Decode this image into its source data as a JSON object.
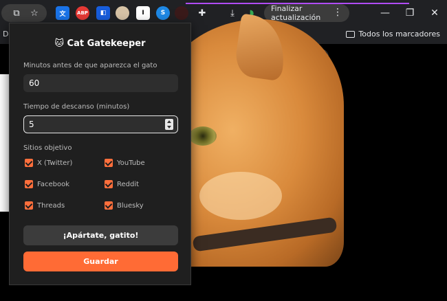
{
  "toolbar": {
    "update_label": "Finalizar actualización",
    "icons": [
      "install-icon",
      "star-icon",
      "translate-icon",
      "adblock-icon",
      "bitwarden-icon",
      "avatar-icon",
      "instapaper-icon",
      "shazam-icon",
      "cat-extension-icon",
      "puzzle-icon",
      "download-icon",
      "vpn-icon"
    ],
    "abp_text": "ABP"
  },
  "bookmarks": {
    "left_text": "DI",
    "all_bookmarks": "Todos los marcadores"
  },
  "popup": {
    "title": "🐱 Cat Gatekeeper",
    "minutes_label": "Minutos antes de que aparezca el gato",
    "minutes_value": "60",
    "rest_label": "Tiempo de descanso (minutos)",
    "rest_value": "5",
    "sites_label": "Sitios objetivo",
    "sites": [
      {
        "label": "X (Twitter)",
        "checked": true
      },
      {
        "label": "YouTube",
        "checked": true
      },
      {
        "label": "Facebook",
        "checked": true
      },
      {
        "label": "Reddit",
        "checked": true
      },
      {
        "label": "Threads",
        "checked": true
      },
      {
        "label": "Bluesky",
        "checked": true
      }
    ],
    "dismiss_button": "¡Apártate, gatito!",
    "save_button": "Guardar"
  },
  "colors": {
    "accent": "#ff6b35",
    "popup_bg": "#1f1f1f",
    "toolbar_bg": "#202124"
  }
}
